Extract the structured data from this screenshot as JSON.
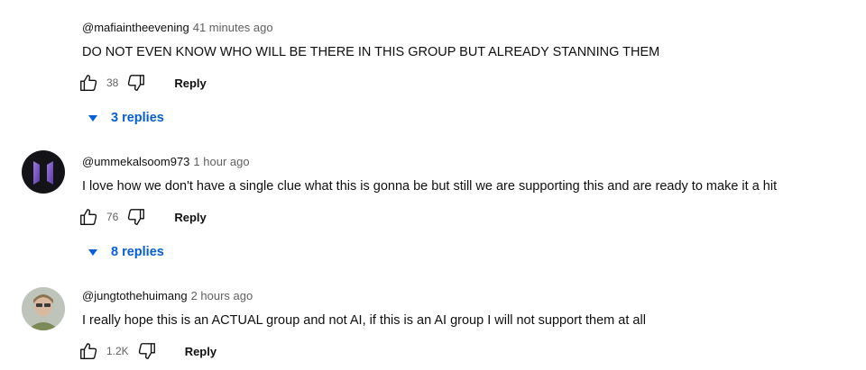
{
  "comments": [
    {
      "author": "@mafiaintheevening",
      "time": "41 minutes ago",
      "text": "DO NOT EVEN KNOW WHO WILL BE THERE IN THIS GROUP BUT ALREADY STANNING THEM",
      "likes": "38",
      "reply_label": "Reply",
      "replies_label": "3 replies"
    },
    {
      "author": "@ummekalsoom973",
      "time": "1 hour ago",
      "text": "I love how we don't have a single clue what this is gonna be but still we are supporting this and are ready to make it a hit",
      "likes": "76",
      "reply_label": "Reply",
      "replies_label": "8 replies"
    },
    {
      "author": "@jungtothehuimang",
      "time": "2 hours ago",
      "text": "I really hope this is an ACTUAL group and not AI, if this is an AI group I will not support them at all",
      "likes": "1.2K",
      "reply_label": "Reply"
    }
  ],
  "colors": {
    "link": "#065fd4",
    "meta": "#606060",
    "text": "#0f0f0f"
  },
  "icons": [
    "thumbs-up-icon",
    "thumbs-down-icon",
    "caret-down-icon"
  ]
}
